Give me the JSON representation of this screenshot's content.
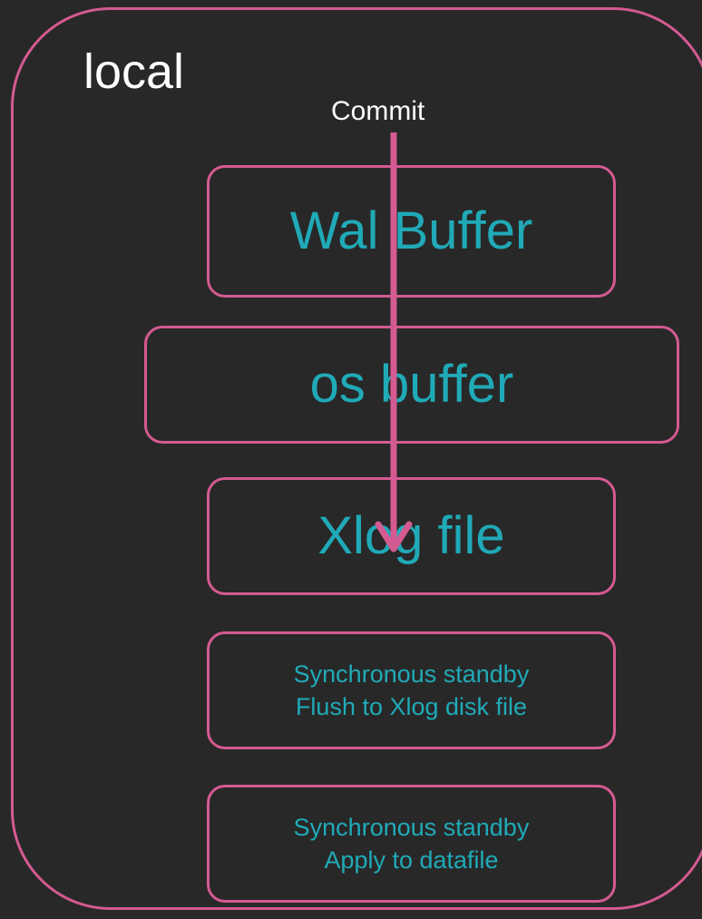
{
  "diagram": {
    "container_label": "local",
    "arrow_label": "Commit",
    "boxes": [
      {
        "lines": [
          "Wal Buffer"
        ]
      },
      {
        "lines": [
          "os buffer"
        ]
      },
      {
        "lines": [
          "Xlog file"
        ]
      },
      {
        "lines": [
          "Synchronous standby",
          "Flush to Xlog disk file"
        ]
      },
      {
        "lines": [
          "Synchronous standby",
          "Apply to datafile"
        ]
      }
    ]
  },
  "colors": {
    "background": "#282828",
    "border": "#d45a92",
    "box_text": "#20aab8",
    "label_text": "#ffffff",
    "arrow": "#d45a92"
  }
}
